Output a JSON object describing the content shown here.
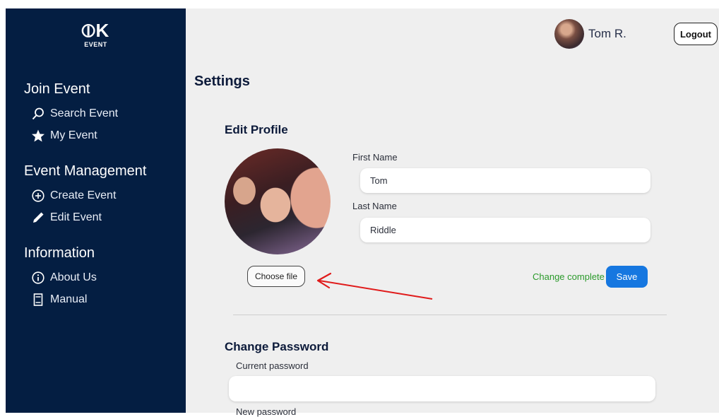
{
  "brand": {
    "logo_text": "⦶K",
    "logo_sub": "EVENT"
  },
  "sidebar": {
    "groups": [
      {
        "heading": "Join Event",
        "items": [
          {
            "label": "Search Event",
            "icon": "search-icon"
          },
          {
            "label": "My Event",
            "icon": "star-icon"
          }
        ]
      },
      {
        "heading": "Event Management",
        "items": [
          {
            "label": "Create Event",
            "icon": "plus-circle-icon"
          },
          {
            "label": "Edit Event",
            "icon": "pencil-icon"
          }
        ]
      },
      {
        "heading": "Information",
        "items": [
          {
            "label": "About Us",
            "icon": "info-icon"
          },
          {
            "label": "Manual",
            "icon": "document-icon"
          }
        ]
      }
    ]
  },
  "header": {
    "user_name": "Tom R.",
    "logout_label": "Logout"
  },
  "settings": {
    "title": "Settings",
    "edit_profile": {
      "title": "Edit Profile",
      "first_name_label": "First Name",
      "first_name_value": "Tom",
      "last_name_label": "Last Name",
      "last_name_value": "Riddle",
      "choose_file_label": "Choose file",
      "status": "Change complete",
      "save_label": "Save"
    },
    "change_password": {
      "title": "Change Password",
      "current_label": "Current password",
      "current_value": "",
      "new_label": "New password"
    }
  },
  "colors": {
    "sidebar_bg": "#041e42",
    "main_bg": "#efefef",
    "primary": "#1677e0",
    "success": "#2b9a2b",
    "annotation_arrow": "#e01b1b"
  }
}
